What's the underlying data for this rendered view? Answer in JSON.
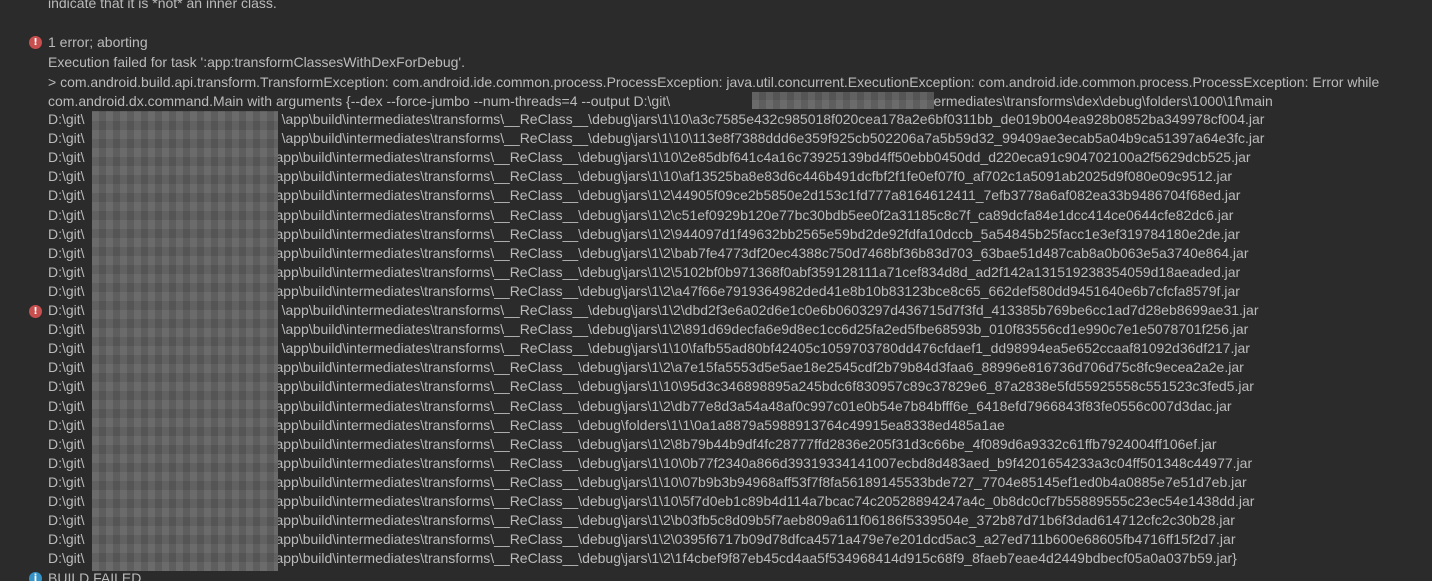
{
  "console": {
    "top_text": "indicate that it is *not* an inner class.",
    "error_summary": "1 error; aborting",
    "task_failed": "Execution failed for task ':app:transformClassesWithDexForDebug'.",
    "exception": "> com.android.build.api.transform.TransformException: com.android.ide.common.process.ProcessException: java.util.concurrent.ExecutionException: com.android.ide.common.process.ProcessException: Error while",
    "main_args_prefix": "com.android.dx.command.Main with arguments {--dex --force-jumbo --num-threads=4 --output D:\\git\\",
    "main_args_suffix": "\\app\\build\\intermediates\\transforms\\dex\\debug\\folders\\1000\\1f\\main",
    "path_prefix": "D:\\git\\",
    "paths": [
      "\\app\\build\\intermediates\\transforms\\__ReClass__\\debug\\jars\\1\\10\\a3c7585e432c985018f020cea178a2e6bf0311bb_de019b004ea928b0852ba349978cf004.jar",
      "\\app\\build\\intermediates\\transforms\\__ReClass__\\debug\\jars\\1\\10\\113e8f7388ddd6e359f925cb502206a7a5b59d32_99409ae3ecab5a04b9ca51397a64e3fc.jar",
      "\\app\\build\\intermediates\\transforms\\__ReClass__\\debug\\jars\\1\\10\\2e85dbf641c4a16c73925139bd4ff50ebb0450dd_d220eca91c904702100a2f5629dcb525.jar",
      "\\app\\build\\intermediates\\transforms\\__ReClass__\\debug\\jars\\1\\10\\af13525ba8e83d6c446b491dcfbf2f1fe0ef07f0_af702c1a5091ab2025d9f080e09c9512.jar",
      "\\app\\build\\intermediates\\transforms\\__ReClass__\\debug\\jars\\1\\2\\44905f09ce2b5850e2d153c1fd777a8164612411_7efb3778a6af082ea33b9486704f68ed.jar",
      "\\app\\build\\intermediates\\transforms\\__ReClass__\\debug\\jars\\1\\2\\c51ef0929b120e77bc30bdb5ee0f2a31185c8c7f_ca89dcfa84e1dcc414ce0644cfe82dc6.jar",
      "\\app\\build\\intermediates\\transforms\\__ReClass__\\debug\\jars\\1\\2\\944097d1f49632bb2565e59bd2de92fdfa10dccb_5a54845b25facc1e3ef319784180e2de.jar",
      "\\app\\build\\intermediates\\transforms\\__ReClass__\\debug\\jars\\1\\2\\bab7fe4773df20ec4388c750d7468bf36b83d703_63bae51d487cab8a0b063e5a3740e864.jar",
      "\\app\\build\\intermediates\\transforms\\__ReClass__\\debug\\jars\\1\\2\\5102bf0b971368f0abf359128111a71cef834d8d_ad2f142a131519238354059d18aeaded.jar",
      "\\app\\build\\intermediates\\transforms\\__ReClass__\\debug\\jars\\1\\2\\a47f66e7919364982ded41e8b10b83123bce8c65_662def580dd9451640e6b7cfcfa8579f.jar",
      "\\app\\build\\intermediates\\transforms\\__ReClass__\\debug\\jars\\1\\2\\dbd2f3e6a02d6e1c0e6b0603297d436715d7f3fd_413385b769be6cc1ad7d28eb8699ae31.jar",
      "\\app\\build\\intermediates\\transforms\\__ReClass__\\debug\\jars\\1\\2\\891d69decfa6e9d8ec1cc6d25fa2ed5fbe68593b_010f83556cd1e990c7e1e5078701f256.jar",
      "\\app\\build\\intermediates\\transforms\\__ReClass__\\debug\\jars\\1\\10\\fafb55ad80bf42405c1059703780dd476cfdaef1_dd98994ea5e652ccaaf81092d36df217.jar",
      "\\app\\build\\intermediates\\transforms\\__ReClass__\\debug\\jars\\1\\2\\a7e15fa5553d5e5ae18e2545cdf2b79b84d3faa6_88996e816736d706d75c8fc9ecea2a2e.jar",
      "\\app\\build\\intermediates\\transforms\\__ReClass__\\debug\\jars\\1\\10\\95d3c346898895a245bdc6f830957c89c37829e6_87a2838e5fd55925558c551523c3fed5.jar",
      "\\app\\build\\intermediates\\transforms\\__ReClass__\\debug\\jars\\1\\2\\db77e8d3a54a48af0c997c01e0b54e7b84bfff6e_6418efd7966843f83fe0556c007d3dac.jar",
      "\\app\\build\\intermediates\\transforms\\__ReClass__\\debug\\folders\\1\\1\\0a1a8879a5988913764c49915ea8338ed485a1ae",
      "\\app\\build\\intermediates\\transforms\\__ReClass__\\debug\\jars\\1\\2\\8b79b44b9df4fc28777ffd2836e205f31d3c66be_4f089d6a9332c61ffb7924004ff106ef.jar",
      "\\app\\build\\intermediates\\transforms\\__ReClass__\\debug\\jars\\1\\10\\0b77f2340a866d39319334141007ecbd8d483aed_b9f4201654233a3c04ff501348c44977.jar",
      "\\app\\build\\intermediates\\transforms\\__ReClass__\\debug\\jars\\1\\10\\07b9b3b94968aff53f7f8fa56189145533bde727_7704e85145ef1ed0b4a0885e7e51d7eb.jar",
      "\\app\\build\\intermediates\\transforms\\__ReClass__\\debug\\jars\\1\\10\\5f7d0eb1c89b4d114a7bcac74c20528894247a4c_0b8dc0cf7b55889555c23ec54e1438dd.jar",
      "\\app\\build\\intermediates\\transforms\\__ReClass__\\debug\\jars\\1\\2\\b03fb5c8d09b5f7aeb809a611f06186f5339504e_372b87d71b6f3dad614712cfc2c30b28.jar",
      "\\app\\build\\intermediates\\transforms\\__ReClass__\\debug\\jars\\1\\2\\0395f6717b09d78dfca4571a479e7e201dcd5ac3_a27ed711b600e68605fb4716ff15f2d7.jar",
      "\\app\\build\\intermediates\\transforms\\__ReClass__\\debug\\jars\\1\\2\\1f4cbef9f87eb45cd4aa5f534968414d915c68f9_8faeb7eae4d2449bdbecf05a0a037b59.jar}"
    ],
    "build_failed": "BUILD FAILED",
    "colors": {
      "background": "#2b2b2b",
      "text": "#bbbbbb",
      "error_icon": "#c94f4f",
      "info_icon": "#3592c4",
      "redaction": "#5d5d5d"
    },
    "icons": {
      "error": "error-circle-icon",
      "info": "info-circle-icon"
    }
  }
}
